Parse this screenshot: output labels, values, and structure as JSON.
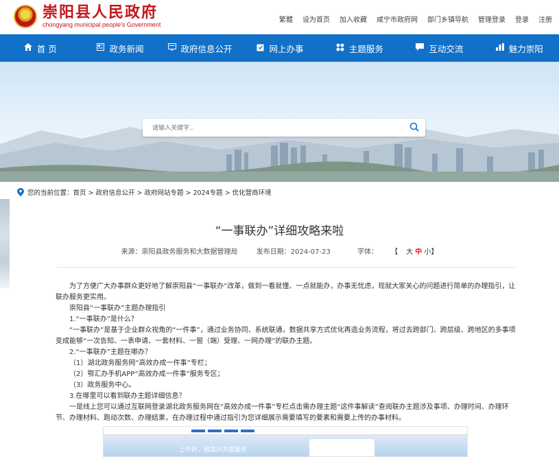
{
  "header": {
    "site_name": "崇阳县人民政府",
    "site_name_en": "chongyang municipal people's Government",
    "top_links": [
      "繁體",
      "设为首页",
      "加入收藏",
      "咸宁市政府网",
      "部门乡镇导航",
      "管理登录",
      "登录",
      "注册"
    ]
  },
  "nav": {
    "items": [
      {
        "label": "首 页",
        "icon": "home-icon"
      },
      {
        "label": "政务新闻",
        "icon": "newspaper-icon"
      },
      {
        "label": "政府信息公开",
        "icon": "monitor-icon"
      },
      {
        "label": "网上办事",
        "icon": "clipboard-icon"
      },
      {
        "label": "主题服务",
        "icon": "grid-icon"
      },
      {
        "label": "互动交流",
        "icon": "chat-icon"
      },
      {
        "label": "魅力崇阳",
        "icon": "chart-icon"
      }
    ]
  },
  "search": {
    "placeholder": "请输入关键字..."
  },
  "breadcrumb": {
    "text": "您的当前位置：首页 > 政府信息公开 > 政府网站专题 > 2024专题 > 优化营商环境"
  },
  "article": {
    "title": "“一事联办”详细攻略来啦",
    "source": "来源：崇阳县政务服务和大数据管理局",
    "date": "发布日期：2024-07-23",
    "font_label": "字体：",
    "font_open": "【",
    "font_big": "大",
    "font_mid": "中",
    "font_small": "小",
    "font_close": "】",
    "paragraphs": [
      "为了方便广大办事群众更好地了解崇阳县“一事联办”改革，做到一看就懂、一点就能办，办事无忧虑，现就大家关心的问题进行简单的办理指引，让联办服务更实用。",
      "崇阳县“一事联办”主题办理指引",
      "1.“一事联办”是什么？",
      "“一事联办”是基于企业群众视角的“一件事”，通过业务协同、系统联通，数据共享方式优化再造业务流程，将过去跨部门、跨层级、跨地区的多事项变成能够“一次告知、一表申请、一套材料、一窗（端）受理、一网办理”的联办主题。",
      "2.“一事联办”主题在哪办？",
      "（1）湖北政务服务网“高效办成一件事”专栏；",
      "（2）鄂汇办手机APP“高效办成一件事”服务专区；",
      "（3）政务服务中心。",
      "3.在哪里可以看到联办主题详细信息？",
      "一是线上您可以通过互联网登录湖北政务服务网在“高效办成一件事”专栏点击需办理主题“这件事解读”查阅联办主题涉及事项、办理时间、办理环节、办理材料、跑动次数、办理结果，在办理过程中通过指引为您详细展示需要填写的要素和需要上传的办事材料。"
    ],
    "image_slogan": "上午好，肩高兴为您服务"
  },
  "colors": {
    "nav_bg": "#1170c8",
    "brand_red": "#c2161b",
    "accent_red": "#e0201a"
  }
}
